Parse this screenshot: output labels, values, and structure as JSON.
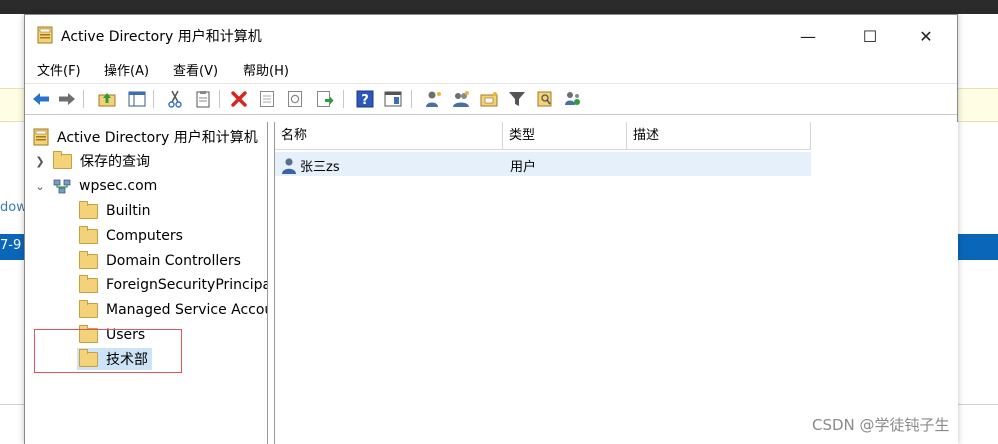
{
  "window": {
    "title": "Active Directory 用户和计算机",
    "controls": {
      "minimize": "—",
      "maximize": "☐",
      "close": "✕"
    }
  },
  "menu": [
    {
      "label": "文件(F)"
    },
    {
      "label": "操作(A)"
    },
    {
      "label": "查看(V)"
    },
    {
      "label": "帮助(H)"
    }
  ],
  "toolbar_icons": [
    "back-arrow-icon",
    "forward-arrow-icon",
    "up-folder-icon",
    "show-tree-icon",
    "cut-icon",
    "copy-icon",
    "delete-icon",
    "properties-icon",
    "refresh-icon",
    "export-list-icon",
    "help-icon",
    "view-icon",
    "new-user-icon",
    "new-group-icon",
    "new-ou-icon",
    "filter-icon",
    "find-icon",
    "add-to-group-icon"
  ],
  "tree": {
    "root": "Active Directory 用户和计算机",
    "saved_queries": "保存的查询",
    "domain": "wpsec.com",
    "children": [
      {
        "label": "Builtin"
      },
      {
        "label": "Computers"
      },
      {
        "label": "Domain Controllers"
      },
      {
        "label": "ForeignSecurityPrincipals"
      },
      {
        "label": "Managed Service Accounts"
      },
      {
        "label": "Users"
      },
      {
        "label": "技术部"
      }
    ]
  },
  "list": {
    "columns": [
      "名称",
      "类型",
      "描述"
    ],
    "rows": [
      {
        "name": "张三zs",
        "type": "用户",
        "description": ""
      }
    ]
  },
  "background": {
    "fragment_left": "dow",
    "fragment_blue": "7-9"
  },
  "watermark": "CSDN @学徒钝子生"
}
